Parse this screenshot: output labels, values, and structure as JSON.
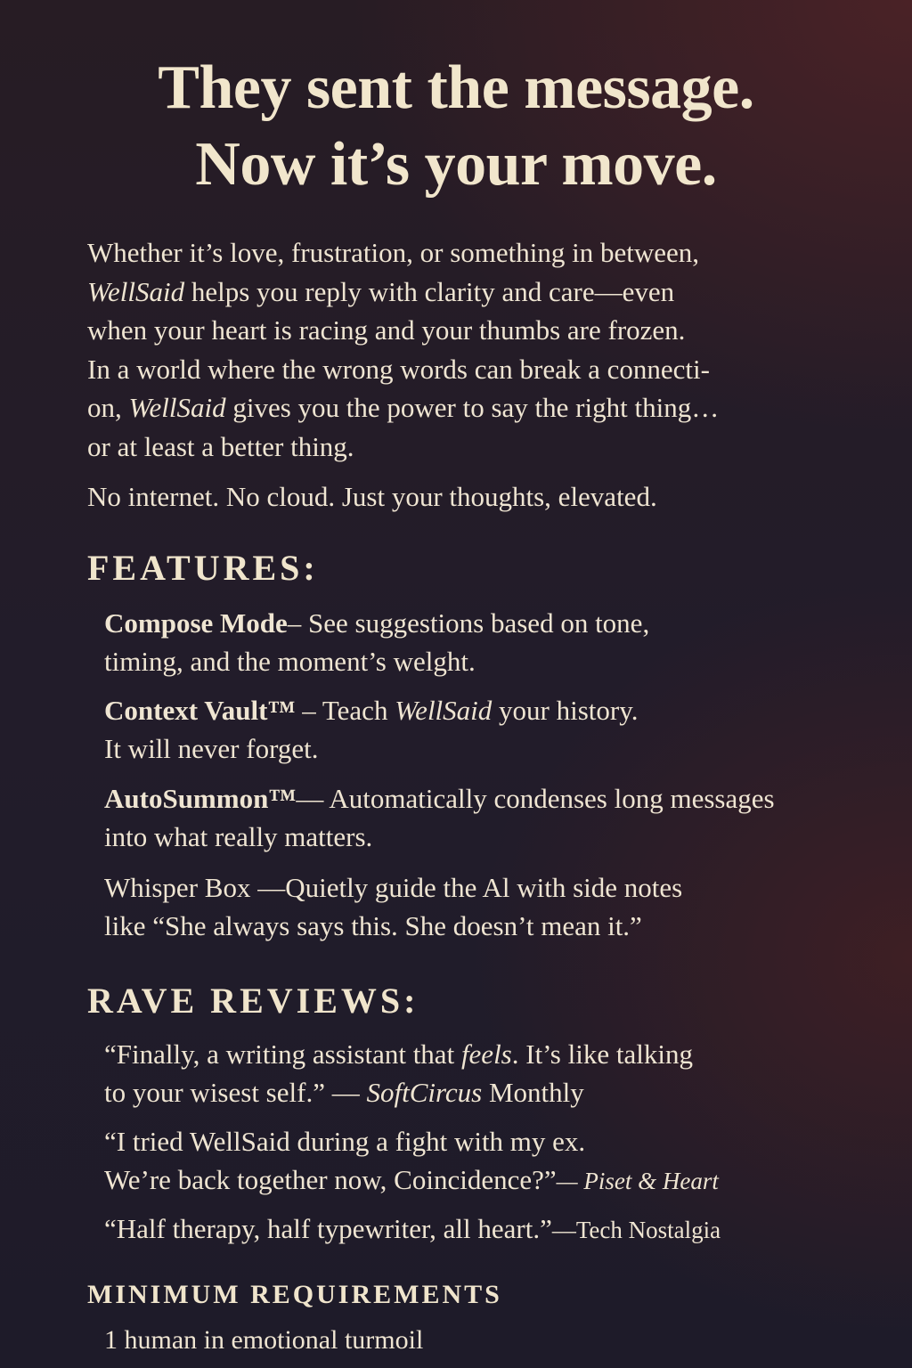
{
  "headline": {
    "line1": "They sent the message.",
    "line2": "Now it’s your move."
  },
  "intro": {
    "l1": "Whether it’s love, frustration, or something in between,",
    "l2_brand": "WellSaid",
    "l2_rest": " helps you reply with clarity and care—even",
    "l3": "when your heart is racing and your thumbs are frozen.",
    "l4": "In a world where the wrong words can break a connecti-",
    "l5_a": "on, ",
    "l5_brand": "WellSaid",
    "l5_rest": " gives you the power to say the right thing…",
    "l6": "or at least a better thing."
  },
  "tagline": "No internet. No cloud. Just your thoughts, elevated.",
  "features": {
    "heading": "FEATURES:",
    "compose": {
      "name": "Compose Mode",
      "l1": "– See suggestions based on tone,",
      "l2": "timing, and the moment’s welght."
    },
    "vault": {
      "name": "Context Vault™",
      "l1_a": " – Teach ",
      "l1_brand": "WellSaid",
      "l1_b": " your history.",
      "l2": "It will never forget."
    },
    "autosummon": {
      "name": "AutoSummon™",
      "l1": "— Automatically condenses long messages",
      "l2": "into what really matters."
    },
    "whisper": {
      "l1": "Whisper Box —Quietly guide the Al with side notes",
      "l2": "like “She always says this. She doesn’t mean it.”"
    }
  },
  "reviews": {
    "heading": "RAVE REVIEWS:",
    "r1": {
      "l1_a": "“Finally, a writing assistant that ",
      "l1_em": "feels",
      "l1_b": ". It’s like talking",
      "l2_a": "to your wisest self.” — ",
      "src_italic": "SoftCircus",
      "src_rest": " Monthly"
    },
    "r2": {
      "l1": "“I tried WellSaid during a fight with my ex.",
      "l2": "We’re back together now, Coincidence?”",
      "src": "— Piset & Heart"
    },
    "r3": {
      "quote": "“Half therapy, half typewriter, all heart.”",
      "src": "—Tech Nostalgia"
    }
  },
  "requirements": {
    "heading": "MINIMUM REQUIREMENTS",
    "item": "1 human in emotional turmoil"
  }
}
